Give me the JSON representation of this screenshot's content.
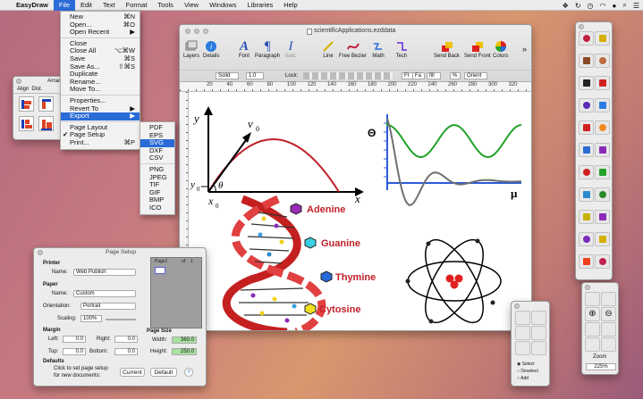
{
  "menubar": {
    "apple": "",
    "app": "EasyDraw",
    "items": [
      "File",
      "Edit",
      "Text",
      "Format",
      "Tools",
      "View",
      "Windows",
      "Libraries",
      "Help"
    ]
  },
  "file_menu": [
    {
      "label": "New",
      "sc": "⌘N"
    },
    {
      "label": "Open...",
      "sc": "⌘O"
    },
    {
      "label": "Open Recent",
      "sc": "▶"
    },
    {
      "sep": true
    },
    {
      "label": "Close",
      "sc": ""
    },
    {
      "label": "Close All",
      "sc": "⌥⌘W"
    },
    {
      "label": "Save",
      "sc": "⌘S"
    },
    {
      "label": "Save As...",
      "sc": "⇧⌘S"
    },
    {
      "label": "Duplicate",
      "sc": ""
    },
    {
      "label": "Rename...",
      "sc": ""
    },
    {
      "label": "Move To...",
      "sc": ""
    },
    {
      "sep": true
    },
    {
      "label": "Properties...",
      "sc": ""
    },
    {
      "label": "Revert To",
      "sc": "▶"
    },
    {
      "label": "Export",
      "sc": "▶",
      "sel": true
    },
    {
      "sep": true
    },
    {
      "label": "Page Layout",
      "sc": ""
    },
    {
      "label": "Page Setup",
      "sc": "",
      "chk": "✔"
    },
    {
      "label": "Print...",
      "sc": "⌘P"
    }
  ],
  "export_menu": [
    {
      "label": "PDF"
    },
    {
      "label": "EPS"
    },
    {
      "label": "SVG",
      "sel": true
    },
    {
      "label": "DXF"
    },
    {
      "label": "CSV"
    },
    {
      "sep": true
    },
    {
      "label": "PNG"
    },
    {
      "label": "JPEG"
    },
    {
      "label": "TIF"
    },
    {
      "label": "GIF"
    },
    {
      "label": "BMP"
    },
    {
      "label": "ICO"
    }
  ],
  "main_window": {
    "title": "scientificApplications.ezddata",
    "toolbar": [
      "Layers",
      "Details",
      "Font",
      "Paragraph",
      "Italic",
      "Line",
      "Free Bezier",
      "Math",
      "Tech",
      "Send Back",
      "Send Front",
      "Colors"
    ],
    "style_bar": {
      "line_style": "Solid",
      "line_width": "1.0",
      "lock_label": "Lock:",
      "font_size": "Ft",
      "font_fa": "Fa",
      "fill_fill": "fill",
      "percent": "%",
      "orient": "Orient"
    },
    "ruler": [
      "20",
      "40",
      "60",
      "80",
      "100",
      "120",
      "140",
      "160",
      "180",
      "200",
      "220",
      "240",
      "260",
      "280",
      "300",
      "320"
    ],
    "graph1": {
      "y": "y",
      "v0": "v",
      "v0sub": "0",
      "y0": "y",
      "y0sub": "0",
      "theta": "θ",
      "x": "x",
      "x0": "x",
      "x0sub": "0"
    },
    "graph2": {
      "theta": "Θ",
      "mu": "μ"
    },
    "bases": [
      "Adenine",
      "Guanine",
      "Thymine",
      "Cytosine"
    ],
    "colors": {
      "green": "#22a32a",
      "gray": "#707070",
      "blue": "#2a5bd6",
      "red": "#c0202a"
    }
  },
  "arrange": {
    "title": "Arran",
    "tabs": [
      "Align",
      "Dist."
    ]
  },
  "page_setup": {
    "title": "Page Setup",
    "printer_label": "Printer",
    "name_label": "Name:",
    "printer_value": "Web Publish",
    "paper_label": "Paper",
    "paper_name_label": "Name:",
    "paper_value": "Custom",
    "orientation_label": "Orientation:",
    "orientation_value": "Portrait",
    "scaling_label": "Scaling:",
    "scaling_value": "100%",
    "margin_label": "Margin",
    "left_label": "Left:",
    "left_value": "0.0",
    "right_label": "Right:",
    "right_value": "0.0",
    "top_label": "Top:",
    "top_value": "0.0",
    "bottom_label": "Bottom:",
    "bottom_value": "0.0",
    "page_size_label": "Page Size",
    "width_label": "Width:",
    "width_value": "360.0",
    "height_label": "Height:",
    "height_value": "250.0",
    "defaults_label": "Defaults",
    "defaults_text1": "Click to set page setup",
    "defaults_text2": "for new documents:",
    "current_btn": "Current",
    "default_btn": "Default",
    "help": "?",
    "page_label": "Page1",
    "of_label": "of",
    "of_value": "1"
  },
  "select_palette": {
    "options": [
      "Select",
      "Deselect",
      "Add"
    ]
  },
  "zoom_palette": {
    "label": "Zoom",
    "value": "225%"
  }
}
